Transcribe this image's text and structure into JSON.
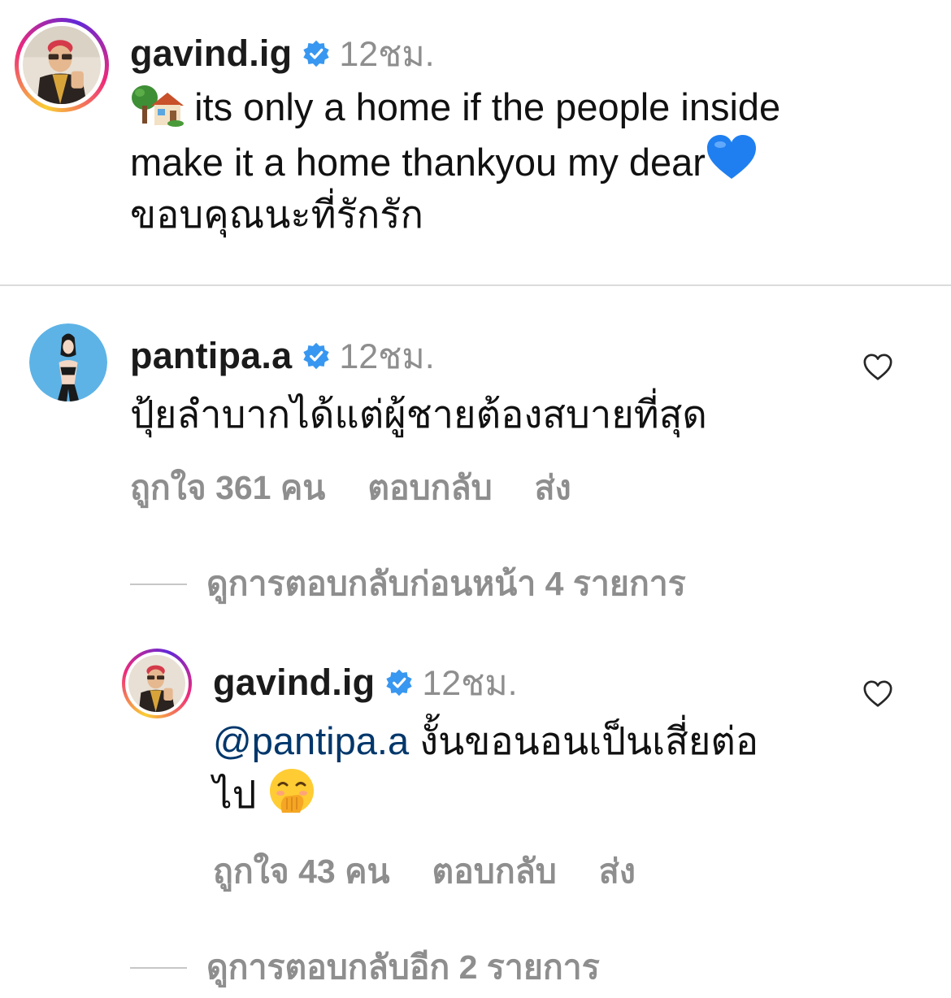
{
  "caption": {
    "username": "gavind.ig",
    "time": "12ชม.",
    "text_line1": "its only a home if the people inside",
    "text_line2": "make it a home thankyou my dear",
    "text_line3": "ขอบคุณนะที่รักรัก",
    "emoji_house": "house-with-garden-emoji",
    "emoji_heart": "blue-heart-emoji"
  },
  "comment": {
    "username": "pantipa.a",
    "time": "12ชม.",
    "text": "ปุ้ยลำบากได้แต่ผู้ชายต้องสบายที่สุด",
    "likes": "ถูกใจ 361 คน",
    "reply_label": "ตอบกลับ",
    "send_label": "ส่ง",
    "view_previous_replies": "ดูการตอบกลับก่อนหน้า 4 รายการ"
  },
  "reply": {
    "username": "gavind.ig",
    "time": "12ชม.",
    "mention": "@pantipa.a",
    "text_line1": " งั้นขอนอนเป็นเสี่ยต่อ",
    "text_line2": "ไป",
    "emoji": "face-with-hand-over-mouth-emoji",
    "likes": "ถูกใจ 43 คน",
    "reply_label": "ตอบกลับ",
    "send_label": "ส่ง",
    "view_more_replies": "ดูการตอบกลับอีก 2 รายการ"
  },
  "colors": {
    "verified_blue": "#3897f0",
    "mention_blue": "#00376b",
    "secondary_text": "#8e8e8e",
    "divider": "#dbdbdb"
  }
}
